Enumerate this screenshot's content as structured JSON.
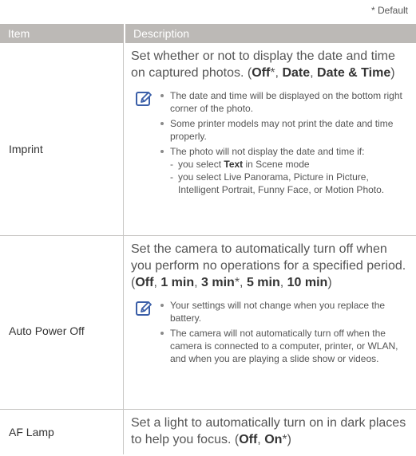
{
  "default_note": "* Default",
  "header": {
    "item": "Item",
    "description": "Description"
  },
  "rows": [
    {
      "item": "Imprint",
      "desc": {
        "prefix": "Set whether or not to display the date and time on captured photos. (",
        "opt1": "Off",
        "sep1": "*, ",
        "opt2": "Date",
        "sep2": ", ",
        "opt3": "Date & Time",
        "suffix": ")"
      },
      "notes": [
        "The date and time will be displayed on the bottom right corner of the photo.",
        "Some printer models may not print the date and time properly.",
        "The photo will not display the date and time if:"
      ],
      "sub_notes": {
        "first_prefix": "you select ",
        "first_bold": "Text",
        "first_suffix": " in Scene mode",
        "second": "you select Live Panorama, Picture in Picture, Intelligent Portrait, Funny Face, or Motion Photo."
      }
    },
    {
      "item": "Auto Power Off",
      "desc": {
        "prefix": "Set the camera to automatically turn off when you perform no operations for a specified period. (",
        "opt1": "Off",
        "sep1": ", ",
        "opt2": "1 min",
        "sep2": ", ",
        "opt3": "3 min",
        "sep3": "*, ",
        "opt4": "5 min",
        "sep4": ", ",
        "opt5": "10 min",
        "suffix": ")"
      },
      "notes": [
        "Your settings will not change when you replace the battery.",
        "The camera will not automatically turn off when the camera is connected to a computer, printer, or WLAN, and when you are playing a slide show or videos."
      ]
    },
    {
      "item": "AF Lamp",
      "desc": {
        "prefix": "Set a light to automatically turn on in dark places to help you focus. (",
        "opt1": "Off",
        "sep1": ", ",
        "opt2": "On",
        "suffix": "*)"
      }
    }
  ],
  "colors": {
    "header_bg": "#bcb9b6",
    "border": "#c9c7c5",
    "icon": "#3b5fa8"
  },
  "icon": "note-pencil-icon"
}
